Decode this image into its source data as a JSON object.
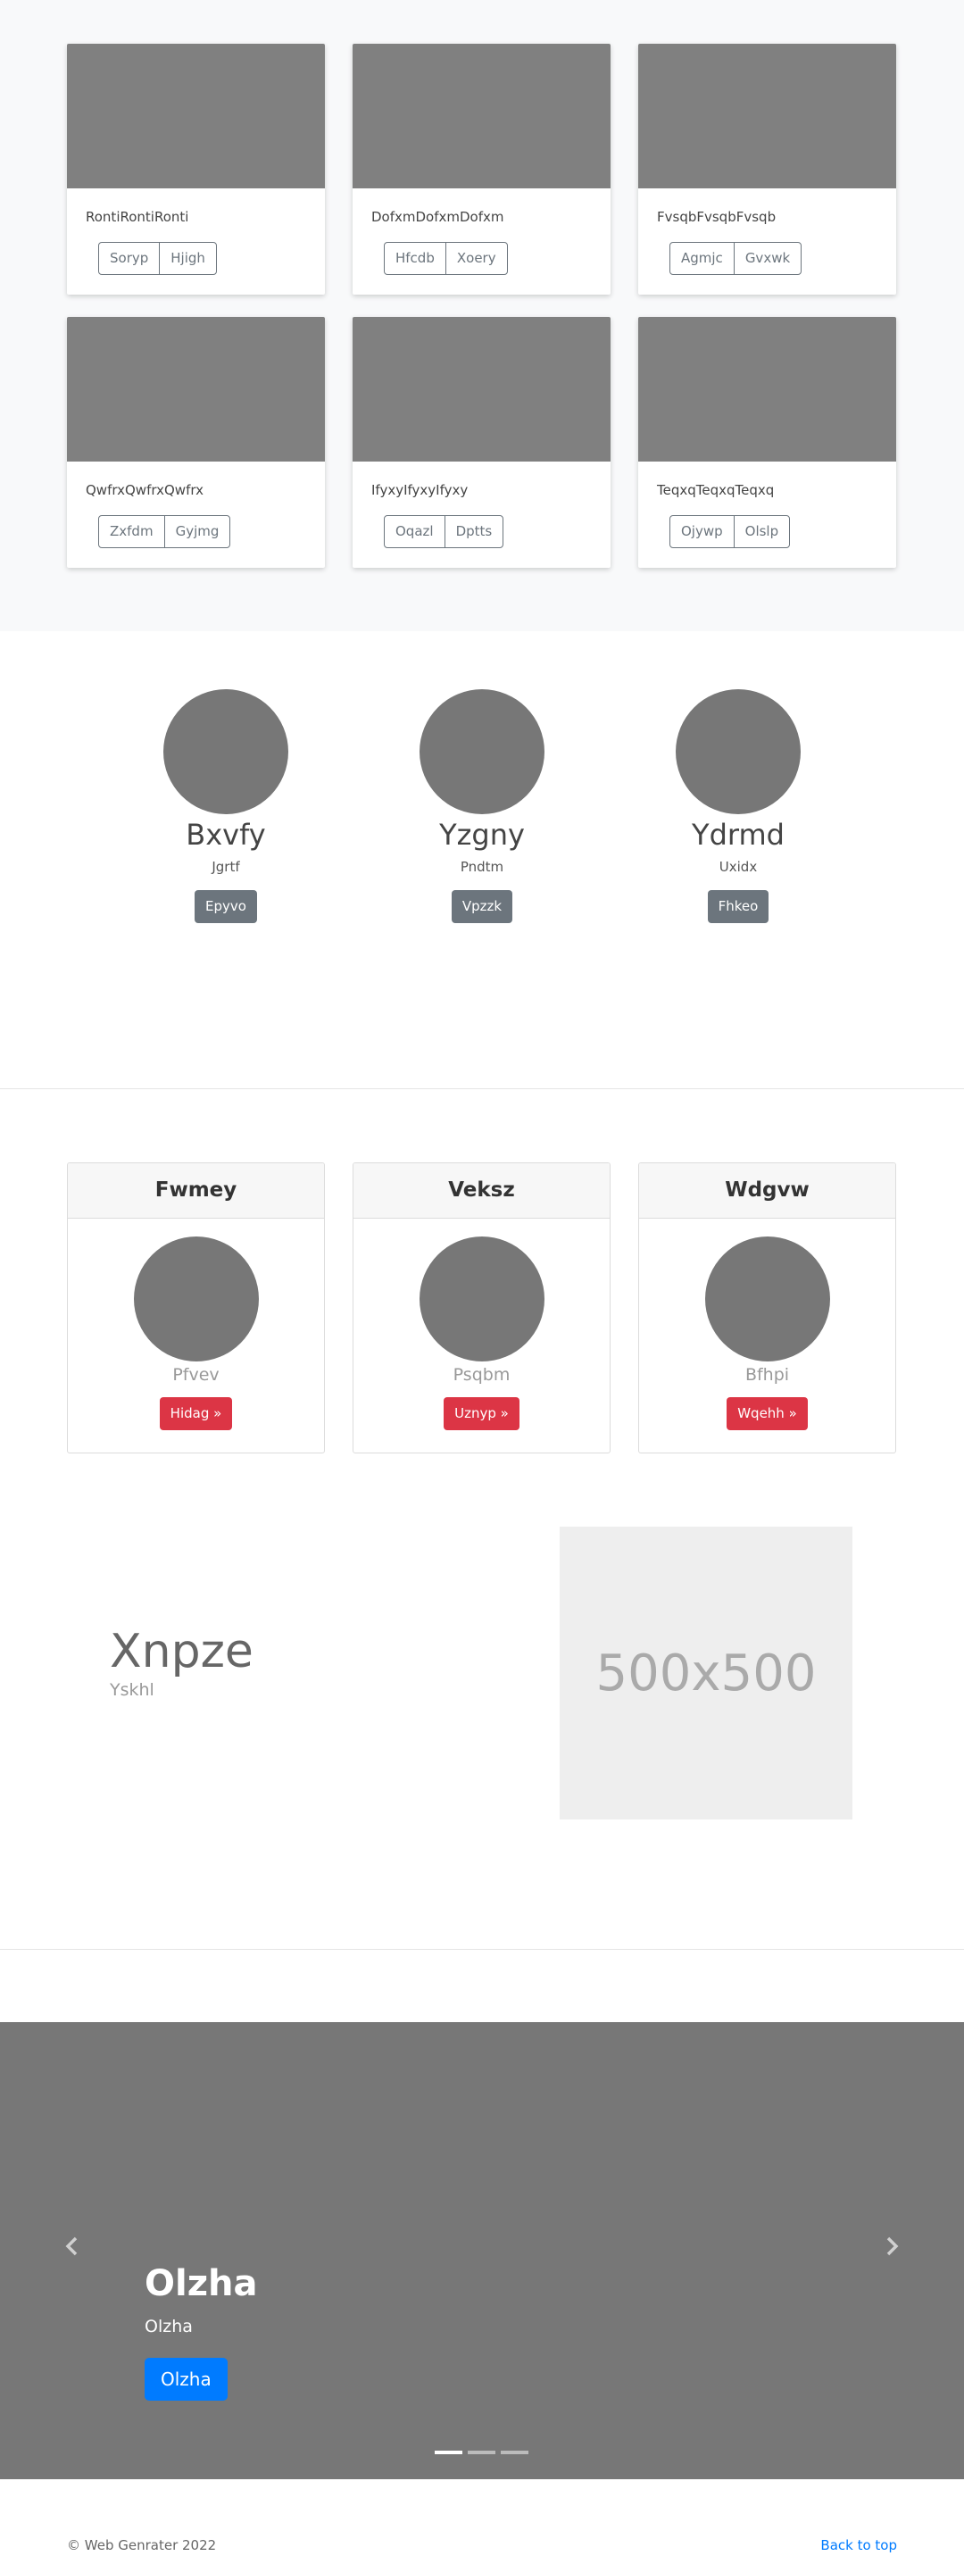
{
  "album": {
    "cards": [
      {
        "text": "RontiRontiRonti",
        "buttons": [
          "Soryp",
          "Hjigh"
        ]
      },
      {
        "text": "DofxmDofxmDofxm",
        "buttons": [
          "Hfcdb",
          "Xoery"
        ]
      },
      {
        "text": "FvsqbFvsqbFvsqb",
        "buttons": [
          "Agmjc",
          "Gvxwk"
        ]
      },
      {
        "text": "QwfrxQwfrxQwfrx",
        "buttons": [
          "Zxfdm",
          "Gyjmg"
        ]
      },
      {
        "text": "IfyxyIfyxyIfyxy",
        "buttons": [
          "Oqazl",
          "Dptts"
        ]
      },
      {
        "text": "TeqxqTeqxqTeqxq",
        "buttons": [
          "Ojywp",
          "Olslp"
        ]
      }
    ]
  },
  "team": {
    "members": [
      {
        "name": "Bxvfy",
        "sub": "Jgrtf",
        "button": "Epyvo"
      },
      {
        "name": "Yzgny",
        "sub": "Pndtm",
        "button": "Vpzzk"
      },
      {
        "name": "Ydrmd",
        "sub": "Uxidx",
        "button": "Fhkeo"
      }
    ]
  },
  "profiles": {
    "cards": [
      {
        "header": "Fwmey",
        "sub": "Pfvev",
        "button": "Hidag »"
      },
      {
        "header": "Veksz",
        "sub": "Psqbm",
        "button": "Uznyp »"
      },
      {
        "header": "Wdgvw",
        "sub": "Bfhpi",
        "button": "Wqehh »"
      }
    ]
  },
  "feature": {
    "title": "Xnpze",
    "subtitle": "Yskhl",
    "placeholder": "500x500"
  },
  "carousel": {
    "title": "Olzha",
    "subtitle": "Olzha",
    "button": "Olzha",
    "slide_count": 3,
    "active_index": 0
  },
  "footer": {
    "copyright": "© Web Genrater 2022",
    "back_to_top": "Back to top"
  }
}
